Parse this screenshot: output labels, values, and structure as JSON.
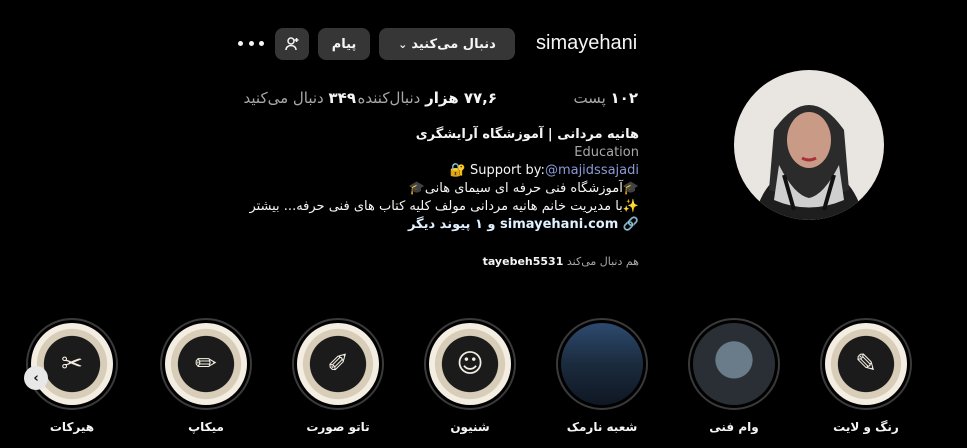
{
  "header": {
    "username": "simayehani",
    "follow_label": "دنبال می‌کنید",
    "message_label": "پیام"
  },
  "stats": {
    "posts_value": "۱۰۲",
    "posts_label": "پست",
    "followers_value": "۷۷,۶ هزار",
    "followers_label": "دنبال‌کننده",
    "following_value": "۳۴۹",
    "following_label": "دنبال می‌کنید"
  },
  "bio": {
    "full_name": "هانیه مردانی | آموزشگاه آرایشگری",
    "category": "Education",
    "support_prefix": "🔐 Support by:",
    "support_handle": "@majidssajadi",
    "line1": "🎓آموزشگاه فنی حرفه ای سیمای هانی🎓",
    "line2": "✨با مدیریت خانم هانیه مردانی مولف کلیه کتاب های فنی حرفه... بیشتر",
    "link": "🔗 simayehani.com و ۱ پیوند دیگر"
  },
  "followed_by": {
    "prefix": "هم دنبال می‌کند",
    "user": "tayebeh5531"
  },
  "highlights": [
    {
      "label": "رنگ و لایت",
      "icon": "cosmetics-icon"
    },
    {
      "label": "وام فنی",
      "icon": "portrait-photo"
    },
    {
      "label": "شعبه نارمک",
      "icon": "storefront-photo"
    },
    {
      "label": "شنیون",
      "icon": "hairstyle-icon"
    },
    {
      "label": "تاتو صورت",
      "icon": "tattoo-machine-icon"
    },
    {
      "label": "میکاپ",
      "icon": "makeup-brush-icon"
    },
    {
      "label": "هیرکات",
      "icon": "scissors-comb-icon"
    }
  ]
}
